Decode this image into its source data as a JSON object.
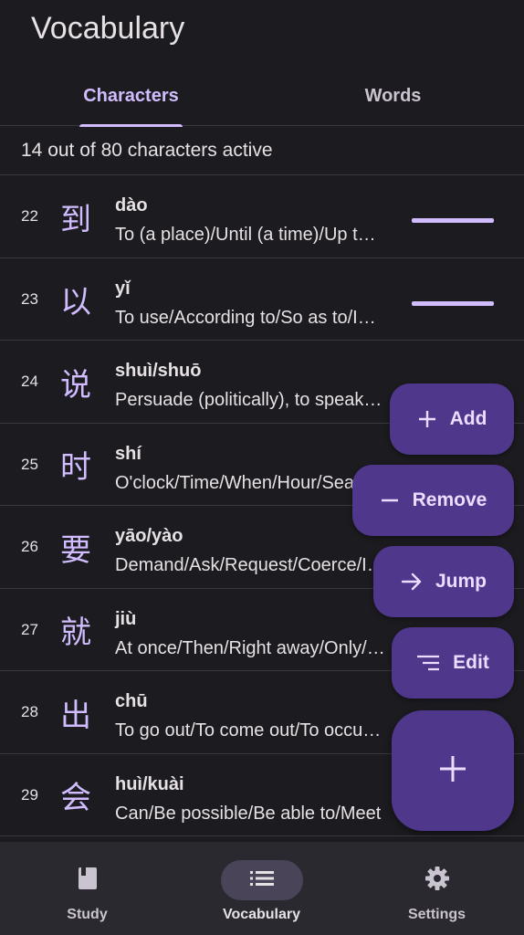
{
  "app": {
    "title": "Vocabulary"
  },
  "tabs": [
    {
      "label": "Characters",
      "selected": true
    },
    {
      "label": "Words",
      "selected": false
    }
  ],
  "status": "14 out of 80 characters active",
  "rows": [
    {
      "num": "22",
      "hanzi": "到",
      "pinyin": "dào",
      "meaning": "To (a place)/Until (a time)/Up to/Arrive",
      "active": true
    },
    {
      "num": "23",
      "hanzi": "以",
      "pinyin": "yǐ",
      "meaning": "To use/According to/So as to/In order to",
      "active": true
    },
    {
      "num": "24",
      "hanzi": "说",
      "pinyin": "shuì/shuō",
      "meaning": "Persuade (politically), to speak/Say",
      "active": false
    },
    {
      "num": "25",
      "hanzi": "时",
      "pinyin": "shí",
      "meaning": "O'clock/Time/When/Hour/Season",
      "active": false
    },
    {
      "num": "26",
      "hanzi": "要",
      "pinyin": "yāo/yào",
      "meaning": "Demand/Ask/Request/Coerce/Important",
      "active": false
    },
    {
      "num": "27",
      "hanzi": "就",
      "pinyin": "jiù",
      "meaning": "At once/Then/Right away/Only/Just",
      "active": false
    },
    {
      "num": "28",
      "hanzi": "出",
      "pinyin": "chū",
      "meaning": "To go out/To come out/To occur/To produce",
      "active": false
    },
    {
      "num": "29",
      "hanzi": "会",
      "pinyin": "huì/kuài",
      "meaning": "Can/Be possible/Be able to/Meet",
      "active": false
    }
  ],
  "fab_menu": {
    "add": "Add",
    "remove": "Remove",
    "jump": "Jump",
    "edit": "Edit"
  },
  "nav": [
    {
      "label": "Study",
      "icon": "book-icon"
    },
    {
      "label": "Vocabulary",
      "icon": "list-icon",
      "selected": true
    },
    {
      "label": "Settings",
      "icon": "gear-icon"
    }
  ],
  "colors": {
    "background": "#1c1b1f",
    "accent": "#d0bcff",
    "fab": "#4f378b",
    "nav_bar": "#2b2930"
  }
}
